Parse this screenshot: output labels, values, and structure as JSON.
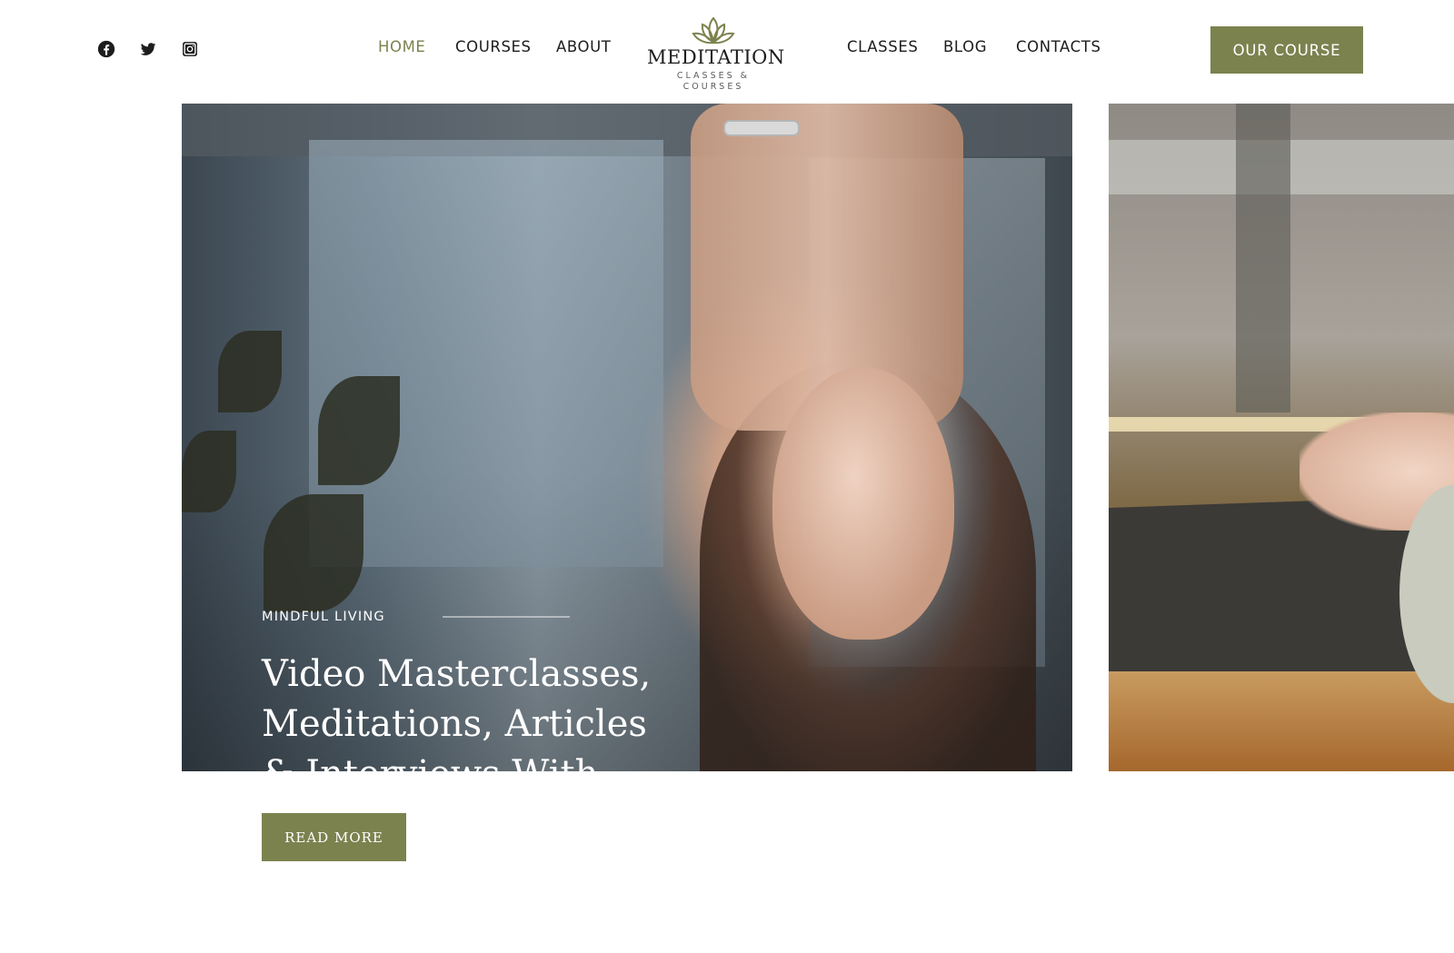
{
  "header": {
    "social": [
      {
        "name": "facebook-icon"
      },
      {
        "name": "twitter-icon"
      },
      {
        "name": "instagram-icon"
      }
    ],
    "nav_left": [
      {
        "label": "Home",
        "active": true
      },
      {
        "label": "Courses",
        "active": false
      },
      {
        "label": "About",
        "active": false
      }
    ],
    "logo": {
      "title": "MEDITATION",
      "subtitle": "CLASSES & COURSES",
      "icon": "lotus-icon"
    },
    "nav_right": [
      {
        "label": "Classes"
      },
      {
        "label": "Blog"
      },
      {
        "label": "Contacts"
      }
    ],
    "cta_label": "Our course"
  },
  "hero": {
    "category": "Mindful Living",
    "title": "Video Masterclasses, Meditations, Articles & Interviews With Experts",
    "button_label": "Read More"
  },
  "colors": {
    "accent": "#7c824e",
    "text": "#1d1d1d",
    "background": "#ffffff"
  }
}
